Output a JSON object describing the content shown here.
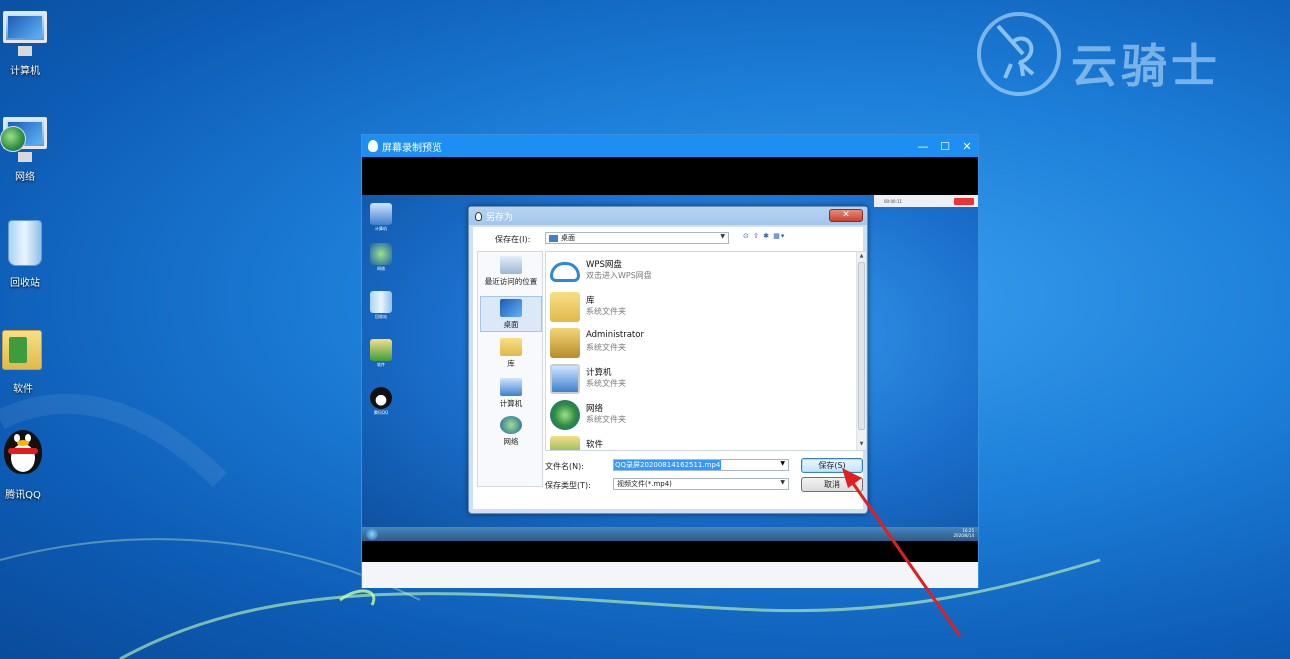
{
  "desktop": {
    "icons": [
      {
        "label": "计算机"
      },
      {
        "label": "网络"
      },
      {
        "label": "回收站"
      },
      {
        "label": "软件"
      },
      {
        "label": "腾讯QQ"
      }
    ],
    "watermark": "云骑士"
  },
  "recorder": {
    "title": "屏幕录制预览",
    "controls": {
      "minimize": "—",
      "maximize": "☐",
      "close": "✕"
    }
  },
  "inner": {
    "icons": [
      "计算机",
      "网络",
      "回收站",
      "软件",
      "腾讯QQ"
    ],
    "tray_time": "16:25",
    "tray_date": "2020/8/14",
    "rec_timer": "00:00:11"
  },
  "dialog": {
    "title": "另存为",
    "save_in_label": "保存在(I):",
    "save_in_value": "桌面",
    "toolbar_icons": "⊙ ⇧ ✱ ▦▾",
    "places": [
      {
        "label": "最近访问的位置"
      },
      {
        "label": "桌面"
      },
      {
        "label": "库"
      },
      {
        "label": "计算机"
      },
      {
        "label": "网络"
      }
    ],
    "files": [
      {
        "name": "WPS网盘",
        "desc": "双击进入WPS网盘",
        "icon": "cloud-icon"
      },
      {
        "name": "库",
        "desc": "系统文件夹",
        "icon": "library-icon"
      },
      {
        "name": "Administrator",
        "desc": "系统文件夹",
        "icon": "user-folder-icon"
      },
      {
        "name": "计算机",
        "desc": "系统文件夹",
        "icon": "computer-icon"
      },
      {
        "name": "网络",
        "desc": "系统文件夹",
        "icon": "network-icon"
      },
      {
        "name": "软件",
        "desc": "",
        "icon": "folder-icon"
      }
    ],
    "filename_label": "文件名(N):",
    "filename_value": "QQ录屏20200814162511.mp4",
    "filetype_label": "保存类型(T):",
    "filetype_value": "视频文件(*.mp4)",
    "save_button": "保存(S)",
    "cancel_button": "取消"
  }
}
